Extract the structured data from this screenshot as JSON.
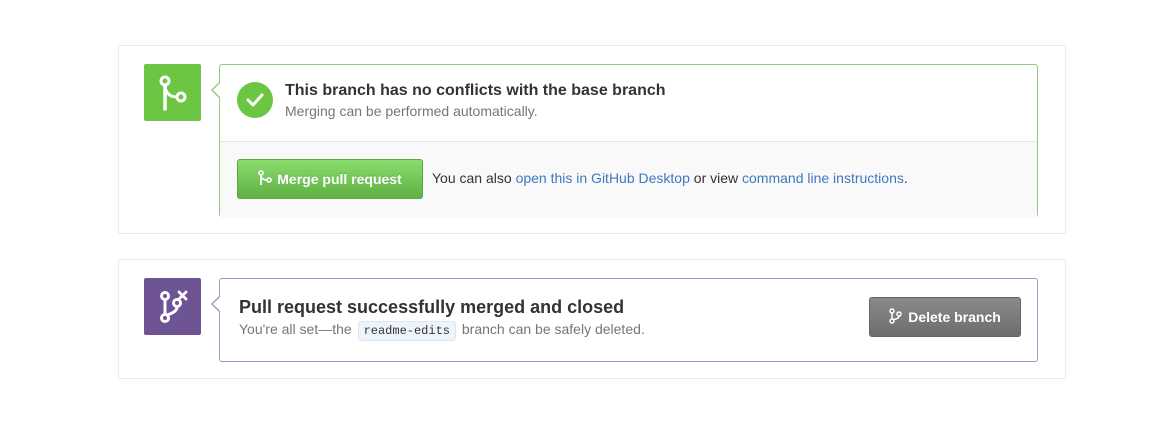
{
  "merge_box": {
    "icon": "git-merge-icon",
    "status_icon": "check-icon",
    "title": "This branch has no conflicts with the base branch",
    "subtitle": "Merging can be performed automatically.",
    "merge_button": {
      "icon": "git-merge-icon",
      "label": "Merge pull request"
    },
    "help_prefix": "You can also ",
    "desktop_link": "open this in GitHub Desktop",
    "help_middle": " or view ",
    "cli_link": "command line instructions",
    "help_suffix": ".",
    "colors": {
      "badge": "#6cc644",
      "button": "#60b044",
      "link": "#4078c0"
    }
  },
  "merged_box": {
    "icon": "git-branch-delete-icon",
    "title": "Pull request successfully merged and closed",
    "subtitle_prefix": "You're all set—the ",
    "branch_name": "readme-edits",
    "subtitle_suffix": " branch can be safely deleted.",
    "delete_button": {
      "icon": "git-branch-icon",
      "label": "Delete branch"
    },
    "colors": {
      "badge": "#6e5494",
      "button": "#767676"
    }
  }
}
